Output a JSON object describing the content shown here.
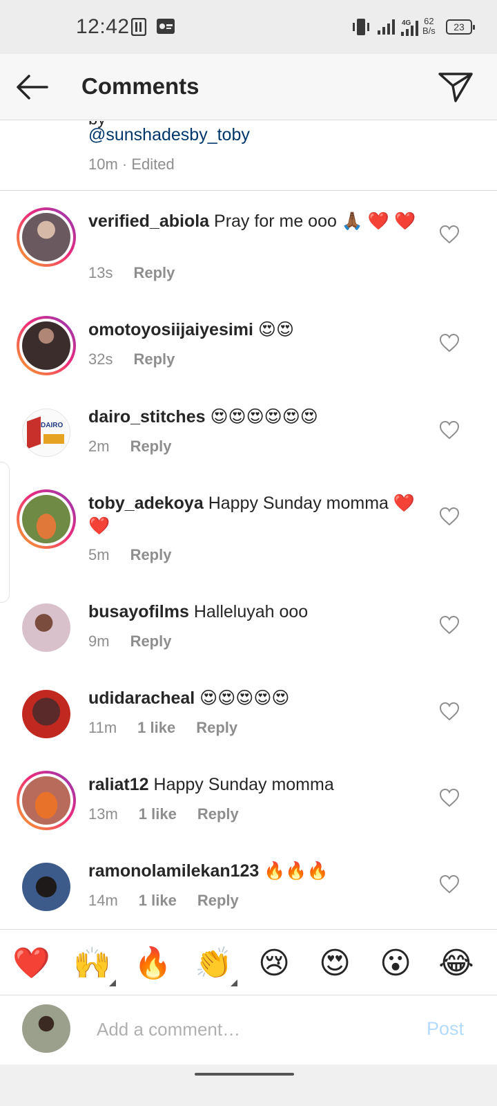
{
  "status_bar": {
    "time": "12:42",
    "net_speed_value": "62",
    "net_speed_unit": "B/s",
    "network_type": "4G",
    "battery": "23"
  },
  "header": {
    "title": "Comments"
  },
  "caption": {
    "cut_text": "by",
    "mention": "@sunshadesby_toby",
    "meta": "10m · Edited"
  },
  "comments": [
    {
      "username": "verified_abiola",
      "text": " Pray for me ooo 🙏🏾 ❤️ ❤️",
      "time": "13s",
      "likes": "",
      "reply": "Reply",
      "story_ring": true,
      "avatar_color": "#7b6a6e"
    },
    {
      "username": "omotoyosiijaiyesimi",
      "text": " 😍😍",
      "time": "32s",
      "likes": "",
      "reply": "Reply",
      "story_ring": true,
      "avatar_color": "#3a2d2c"
    },
    {
      "username": "dairo_stitches",
      "text": " 😍😍😍😍😍😍",
      "time": "2m",
      "likes": "",
      "reply": "Reply",
      "story_ring": false,
      "avatar_color": "#c7302b",
      "avatar_text": "DAIRO"
    },
    {
      "username": "toby_adekoya",
      "text": " Happy Sunday momma ❤️❤️",
      "time": "5m",
      "likes": "",
      "reply": "Reply",
      "story_ring": true,
      "avatar_color": "#e0783a"
    },
    {
      "username": "busayofilms",
      "text": " Halleluyah ooo",
      "time": "9m",
      "likes": "",
      "reply": "Reply",
      "story_ring": false,
      "avatar_color": "#c9a6b4"
    },
    {
      "username": "udidaracheal",
      "text": " 😍😍😍😍😍",
      "time": "11m",
      "likes": "1 like",
      "reply": "Reply",
      "story_ring": false,
      "avatar_color": "#5a2a2a"
    },
    {
      "username": "raliat12",
      "text": " Happy Sunday momma",
      "time": "13m",
      "likes": "1 like",
      "reply": "Reply",
      "story_ring": true,
      "avatar_color": "#e8722a"
    },
    {
      "username": "ramonolamilekan123",
      "text": " 🔥🔥🔥",
      "time": "14m",
      "likes": "1 like",
      "reply": "Reply",
      "story_ring": false,
      "avatar_color": "#2a3550"
    }
  ],
  "emoji_bar": [
    "❤️",
    "🙌",
    "🔥",
    "👏",
    "😢",
    "😍",
    "😮",
    "😂"
  ],
  "composer": {
    "placeholder": "Add a comment…",
    "post_label": "Post"
  },
  "icons": {
    "back": "arrow-left-icon",
    "send": "paper-plane-icon",
    "like": "heart-outline-icon"
  },
  "colors": {
    "link": "#00376b",
    "muted": "#8e8e8e",
    "post_disabled": "#b3dbff"
  }
}
